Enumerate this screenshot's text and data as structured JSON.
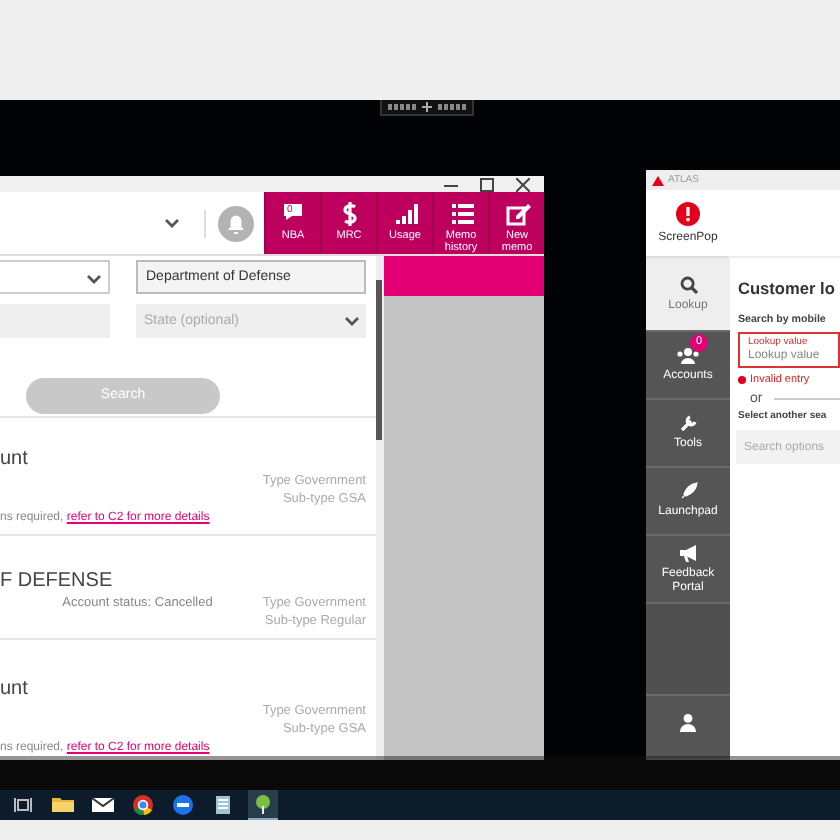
{
  "left_window": {
    "header_buttons": [
      {
        "label": "NBA",
        "badge": "0"
      },
      {
        "label": "MRC"
      },
      {
        "label": "Usage"
      },
      {
        "label": "Memo history"
      },
      {
        "label": "New memo"
      }
    ],
    "organization_field": {
      "value": "Department of Defense"
    },
    "state_field": {
      "placeholder": "State (optional)"
    },
    "search_button": "Search",
    "results": [
      {
        "name": "unt",
        "type": "Type Government",
        "subtype": "Sub-type GSA",
        "note": "ns required, ",
        "link": "refer to C2 for more details"
      },
      {
        "name": "F DEFENSE",
        "status": "Account status: Cancelled",
        "type": "Type Government",
        "subtype": "Sub-type Regular"
      },
      {
        "name": "unt",
        "type": "Type Government",
        "subtype": "Sub-type GSA",
        "note": "ns required, ",
        "link": "refer to C2 for more details"
      }
    ]
  },
  "atlas": {
    "title": "ATLAS",
    "nav": [
      {
        "label": "ScreenPop",
        "kind": "banner",
        "selected": false
      },
      {
        "label": "Lookup",
        "kind": "link",
        "selected": true
      },
      {
        "label": "Accounts",
        "kind": "link",
        "selected": false,
        "badge": "0"
      },
      {
        "label": "Tools",
        "kind": "link",
        "selected": false
      },
      {
        "label": "Launchpad",
        "kind": "link",
        "selected": false
      },
      {
        "label": "Feedback Portal",
        "kind": "link",
        "selected": false
      }
    ],
    "heading": "Customer lo",
    "search_label": "Search by mobile",
    "lookup": {
      "label": "Lookup value",
      "placeholder": "Lookup value",
      "error": "Invalid entry"
    },
    "or": "or",
    "select_label": "Select another sea",
    "options_field": {
      "placeholder": "Search options"
    }
  },
  "taskbar": {
    "apps": [
      {
        "selected": false
      },
      {
        "selected": false
      },
      {
        "selected": false
      },
      {
        "selected": false
      },
      {
        "selected": false
      },
      {
        "selected": false
      },
      {
        "selected": true
      }
    ]
  }
}
